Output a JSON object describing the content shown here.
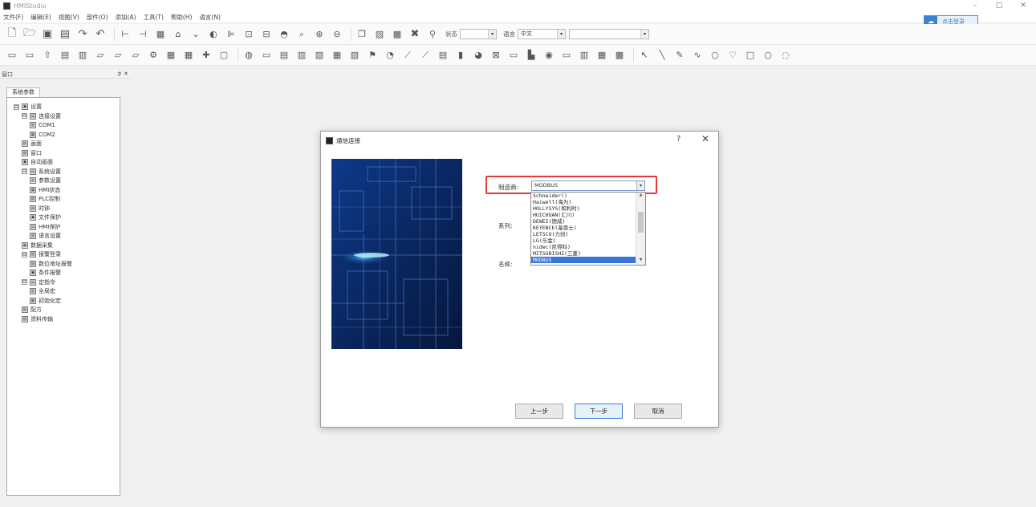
{
  "app": {
    "title": "HMIStudio",
    "minimize": "–",
    "maximize": "□",
    "close": "✕"
  },
  "menu": [
    "文件(F)",
    "编辑(E)",
    "视图(V)",
    "部件(O)",
    "添加(A)",
    "工具(T)",
    "帮助(H)",
    "语言(N)"
  ],
  "login": {
    "label": "点击登录"
  },
  "toolbar": {
    "status_label": "状态",
    "lang_label": "语言",
    "lang_value": "中文"
  },
  "side_panel": {
    "header_title": "窗口",
    "pin": "⊅ ✕",
    "tab_label": "系统参数",
    "tree": [
      {
        "label": "设置",
        "level": 0,
        "expander": "⊟"
      },
      {
        "label": "连接设置",
        "level": 1,
        "expander": "⊟"
      },
      {
        "label": "COM1",
        "level": 2
      },
      {
        "label": "COM2",
        "level": 2
      },
      {
        "label": "画面",
        "level": 1
      },
      {
        "label": "窗口",
        "level": 1
      },
      {
        "label": "自动画面",
        "level": 1
      },
      {
        "label": "系统设置",
        "level": 1,
        "expander": "⊟"
      },
      {
        "label": "参数设置",
        "level": 2
      },
      {
        "label": "HMI状态",
        "level": 2
      },
      {
        "label": "PLC控制",
        "level": 2
      },
      {
        "label": "时钟",
        "level": 2
      },
      {
        "label": "文件保护",
        "level": 2
      },
      {
        "label": "HMI保护",
        "level": 2
      },
      {
        "label": "语言设置",
        "level": 2
      },
      {
        "label": "数据采集",
        "level": 1
      },
      {
        "label": "报警登录",
        "level": 1,
        "expander": "⊟"
      },
      {
        "label": "数位地址报警",
        "level": 2
      },
      {
        "label": "条件报警",
        "level": 2
      },
      {
        "label": "定指令",
        "level": 1,
        "expander": "⊟"
      },
      {
        "label": "全局宏",
        "level": 2
      },
      {
        "label": "初始化宏",
        "level": 2
      },
      {
        "label": "配方",
        "level": 1
      },
      {
        "label": "资料传输",
        "level": 1
      }
    ]
  },
  "dialog": {
    "title": "通信连接",
    "help": "?",
    "close": "✕",
    "manufacturer_label": "制造商:",
    "manufacturer_value": "MODBUS",
    "series_label": "系列:",
    "name_label": "名称:",
    "dropdown_items": [
      "Schneider()",
      "Haiwell(海为)",
      "HOLLYSYS(和利时)",
      "HUICHUAN(汇川)",
      "DEWEI(德威)",
      "KEYENCE(基恩士)",
      "LETSCO(力创)",
      "LG(乐金)",
      "nidec(尼得科)",
      "MITSUBISHI(三菱)",
      "MODBUS"
    ],
    "dropdown_selected_index": 10,
    "buttons": {
      "prev": "上一步",
      "next": "下一步",
      "cancel": "取消"
    }
  }
}
